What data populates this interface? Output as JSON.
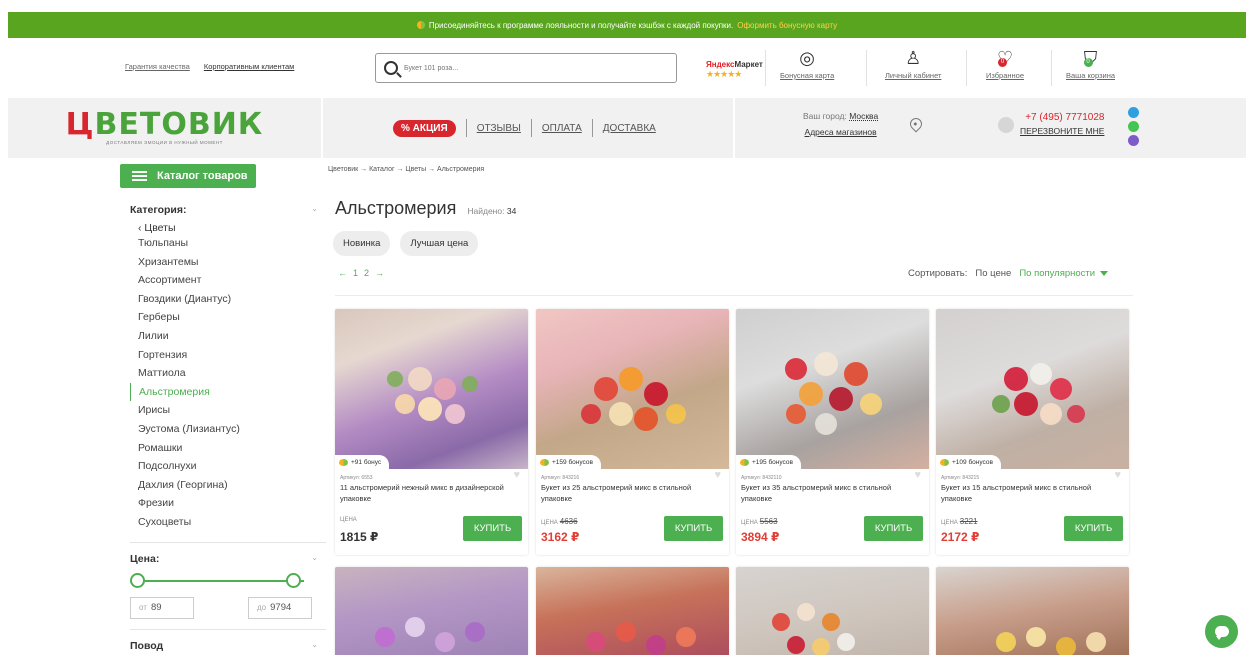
{
  "promo": {
    "text": "Присоединяйтесь к программе лояльности и получайте кэшбэк с каждой покупки.",
    "link": "Оформить бонусную карту"
  },
  "header": {
    "links": [
      "Гарантия качества",
      "Корпоративным клиентам"
    ],
    "search_placeholder": "Букет 101 роза...",
    "market": {
      "brand": "Яндекс",
      "name": "Маркет",
      "stars": "★★★★★"
    },
    "icons": {
      "bonus": "Бонусная карта",
      "account": "Личный кабинет",
      "favorites": "Избранное",
      "favorites_count": "0",
      "cart": "Ваша корзина",
      "cart_count": "0"
    },
    "logo": {
      "first": "Ц",
      "rest": "ВЕТОВИК",
      "tagline": "ДОСТАВЛЯЕМ ЭМОЦИИ В НУЖНЫЙ МОМЕНТ"
    },
    "menu": {
      "sale": "% АКЦИЯ",
      "reviews": "ОТЗЫВЫ",
      "payment": "ОПЛАТА",
      "delivery": "ДОСТАВКА"
    },
    "city": {
      "label": "Ваш город:",
      "value": "Москва",
      "stores": "Адреса магазинов"
    },
    "phone": "+7 (495) 7771028",
    "callback": "ПЕРЕЗВОНИТЕ МНЕ"
  },
  "sidebar": {
    "catalog_button": "Каталог товаров",
    "category_title": "Категория:",
    "back": "Цветы",
    "categories": [
      "Тюльпаны",
      "Хризантемы",
      "Ассортимент",
      "Гвоздики (Диантус)",
      "Герберы",
      "Лилии",
      "Гортензия",
      "Маттиола",
      "Альстромерия",
      "Ирисы",
      "Эустома (Лизиантус)",
      "Ромашки",
      "Подсолнухи",
      "Дахлия (Георгина)",
      "Фрезии",
      "Сухоцветы"
    ],
    "price_title": "Цена:",
    "price_from_label": "от",
    "price_from": "89",
    "price_to_label": "до",
    "price_to": "9794",
    "occasion_title": "Повод"
  },
  "main": {
    "breadcrumb": "Цветовик → Каталог → Цветы → Альстромерия",
    "title": "Альстромерия",
    "found_label": "Найдено:",
    "found_count": "34",
    "chips": [
      "Новинка",
      "Лучшая цена"
    ],
    "pager": {
      "prev": "←",
      "p1": "1",
      "p2": "2",
      "next": "→"
    },
    "sort": {
      "label": "Сортировать:",
      "by_price": "По цене",
      "by_popularity": "По популярности"
    }
  },
  "products": [
    {
      "bonus": "+91 бонус",
      "article": "Артикул: 6553",
      "name": "11 альстромерий нежный микс в дизайнерской упаковке",
      "price_label": "ЦЕНА",
      "old_price": "",
      "price": "1815 ₽",
      "buy": "КУПИТЬ"
    },
    {
      "bonus": "+159 бонусов",
      "article": "Артикул: 843216",
      "name": "Букет из 25 альстромерий микс в стильной упаковке",
      "price_label": "ЦЕНА",
      "old_price": "4636",
      "price": "3162 ₽",
      "buy": "КУПИТЬ"
    },
    {
      "bonus": "+195 бонусов",
      "article": "Артикул: 8432110",
      "name": "Букет из 35 альстромерий микс в стильной упаковке",
      "price_label": "ЦЕНА",
      "old_price": "5563",
      "price": "3894 ₽",
      "buy": "КУПИТЬ"
    },
    {
      "bonus": "+109 бонусов",
      "article": "Артикул: 843215",
      "name": "Букет из 15 альстромерий микс в стильной упаковке",
      "price_label": "ЦЕНА",
      "old_price": "3221",
      "price": "2172 ₽",
      "buy": "КУПИТЬ"
    }
  ],
  "colors": {
    "brand_green": "#4caf50",
    "promo_green": "#5aa51f",
    "sale_red": "#d7262d",
    "price_red": "#e23d35"
  },
  "icons": [
    "search-icon",
    "bonus-card-icon",
    "user-icon",
    "heart-icon",
    "cart-icon",
    "pin-icon",
    "phone-icon",
    "telegram-icon",
    "whatsapp-icon",
    "viber-icon",
    "chat-icon"
  ]
}
